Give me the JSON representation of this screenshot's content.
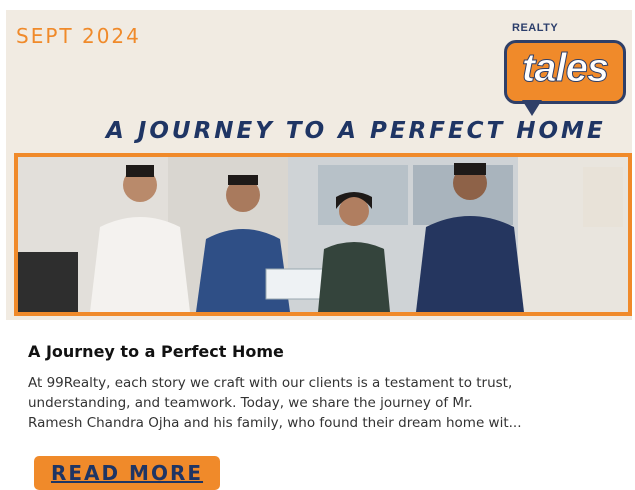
{
  "banner": {
    "date": "SEPT 2024",
    "headline": "A JOURNEY TO A PERFECT HOME",
    "logo": {
      "top_text": "REALTY",
      "word": "tales",
      "brand_color": "#f08a2a",
      "outline_color": "#2f3f68"
    },
    "photo_description_icon": "group-photo-image"
  },
  "article": {
    "title": "A Journey to a Perfect Home",
    "excerpt_lines": [
      "At 99Realty, each story we craft with our clients is a testament to trust,",
      "understanding, and teamwork. Today, we share the journey of Mr.",
      "Ramesh Chandra Ojha and his family, who found their dream home wit..."
    ],
    "read_more_label": "READ MORE"
  },
  "colors": {
    "accent": "#f08a2a",
    "headline": "#1f3564",
    "banner_bg": "#f1ebe2"
  }
}
